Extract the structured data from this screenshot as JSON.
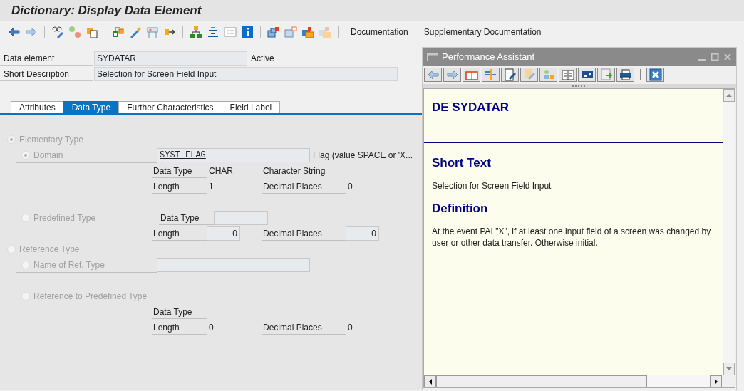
{
  "title": "Dictionary: Display Data Element",
  "toolbar": {
    "text_buttons": [
      "Documentation",
      "Supplementary Documentation"
    ]
  },
  "header_fields": [
    {
      "label": "Data element",
      "value": "SYDATAR",
      "status": "Active"
    },
    {
      "label": "Short Description",
      "value": "Selection for Screen Field Input"
    }
  ],
  "tabs": [
    {
      "label": "Attributes",
      "selected": false
    },
    {
      "label": "Data Type",
      "selected": true
    },
    {
      "label": "Further Characteristics",
      "selected": false
    },
    {
      "label": "Field Label",
      "selected": false
    }
  ],
  "type_options": [
    {
      "label": "Elementary Type",
      "selected": true,
      "disabled": true,
      "children": [
        {
          "kind": "with_field",
          "label": "Domain",
          "selected": true,
          "disabled": true,
          "value": "SYST_FLAG",
          "note": "Flag (value SPACE or 'X...",
          "details": [
            [
              {
                "kind": "text",
                "label": "Data Type",
                "value": "CHAR"
              },
              {
                "kind": "note",
                "label": "Character String"
              }
            ],
            [
              {
                "kind": "text",
                "label": "Length",
                "value": "1"
              },
              {
                "kind": "text",
                "label": "Decimal Places",
                "value": "0"
              }
            ]
          ]
        },
        {
          "kind": "inline_details",
          "label": "Predefined Type",
          "selected": false,
          "disabled": true,
          "details": [
            [
              {
                "kind": "field",
                "label": "Data Type"
              }
            ],
            [
              {
                "kind": "field",
                "label": "Length",
                "value": "0"
              },
              {
                "kind": "field",
                "label": "Decimal Places",
                "value": "0"
              }
            ]
          ]
        }
      ]
    },
    {
      "label": "Reference Type",
      "selected": false,
      "disabled": true,
      "children": [
        {
          "kind": "with_field",
          "label": "Name of Ref. Type",
          "selected": false,
          "disabled": true
        },
        {
          "kind": "plain",
          "label": "Reference to Predefined Type",
          "selected": false,
          "disabled": true,
          "details": [
            [
              {
                "kind": "text",
                "label": "Data Type"
              }
            ],
            [
              {
                "kind": "text",
                "label": "Length",
                "value": "0"
              },
              {
                "kind": "text",
                "label": "Decimal Places",
                "value": "0"
              }
            ]
          ]
        }
      ]
    }
  ],
  "assistant": {
    "title": "Performance Assistant",
    "heading": "DE SYDATAR",
    "sections": [
      {
        "title": "Short Text",
        "text": "Selection for Screen Field Input"
      },
      {
        "title": "Definition",
        "text": "At the event PAI \"X\", if at least one input field of a screen was changed by user or other data transfer. Otherwise initial."
      }
    ]
  }
}
